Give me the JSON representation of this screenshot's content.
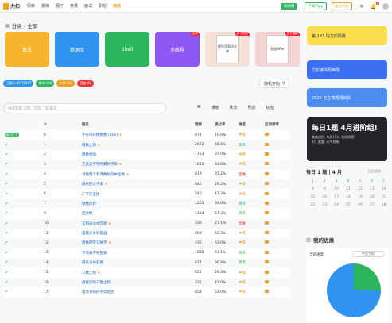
{
  "header": {
    "logo_text": "力扣",
    "nav": [
      "探索",
      "题库",
      "圈子",
      "竞赛",
      "面试",
      "职位"
    ],
    "nav_highlight": "商店",
    "biweek": "双周赛",
    "app": "下载 App",
    "member": "会员中心",
    "lang": "中",
    "notification_count": "4"
  },
  "categories": {
    "title": "分类 - 全部",
    "cards": [
      {
        "label": "算法",
        "color": "#f6b52c"
      },
      {
        "label": "数据库",
        "color": "#2f94f0"
      },
      {
        "label": "Shell",
        "color": "#2db55d"
      },
      {
        "label": "多线程",
        "color": "#8e56f2",
        "tag": "全新"
      },
      {
        "label": "",
        "tag": "新书预售",
        "book": "程序员面试金典"
      },
      {
        "label": "",
        "tag": "官方题解",
        "book": "剑指Offer"
      }
    ]
  },
  "stats": {
    "solved": "已解决 497/1587",
    "easy": "简单 166",
    "medium": "中等 249",
    "hard": "困难 82"
  },
  "random_button": "随机开始",
  "search": {
    "placeholder": "搜索题目 名称、内容、或 编号"
  },
  "filters": [
    "列表",
    "难度",
    "状态",
    "列表",
    "标签"
  ],
  "table": {
    "headers": [
      "#",
      "题名",
      "题解",
      "通过率",
      "难度",
      "出现频率"
    ],
    "rows": [
      {
        "status": "daily",
        "daily_label": "每日打卡",
        "id": "8",
        "title": "字符串转换整数 (atoi)",
        "star": true,
        "sol": "874",
        "acc": "19.0%",
        "diff": "中等",
        "dclass": "med"
      },
      {
        "status": "done",
        "id": "1",
        "title": "两数之和",
        "star": true,
        "sol": "2672",
        "acc": "48.0%",
        "diff": "简单",
        "dclass": "easy"
      },
      {
        "status": "done",
        "id": "2",
        "title": "两数相加",
        "star": false,
        "sol": "1763",
        "acc": "37.0%",
        "diff": "中等",
        "dclass": "med"
      },
      {
        "status": "done",
        "id": "3",
        "title": "无重复字符的最长子串",
        "star": true,
        "sol": "1650",
        "acc": "33.6%",
        "diff": "中等",
        "dclass": "med"
      },
      {
        "status": "done",
        "id": "4",
        "title": "寻找两个有序数组的中位数",
        "star": true,
        "sol": "819",
        "acc": "37.2%",
        "diff": "困难",
        "dclass": "hard"
      },
      {
        "status": "done",
        "id": "5",
        "title": "最长回文子串",
        "star": true,
        "sol": "846",
        "acc": "29.2%",
        "diff": "中等",
        "dclass": "med"
      },
      {
        "status": "done",
        "id": "6",
        "title": "Z 字形变换",
        "star": false,
        "sol": "540",
        "acc": "47.3%",
        "diff": "中等",
        "dclass": "med"
      },
      {
        "status": "done",
        "id": "7",
        "title": "整数反转",
        "star": false,
        "sol": "1265",
        "acc": "34.0%",
        "diff": "简单",
        "dclass": "easy"
      },
      {
        "status": "done",
        "id": "9",
        "title": "回文数",
        "star": false,
        "sol": "1154",
        "acc": "57.3%",
        "diff": "简单",
        "dclass": "easy"
      },
      {
        "status": "done",
        "id": "10",
        "title": "正则表达式匹配",
        "star": true,
        "sol": "330",
        "acc": "27.1%",
        "diff": "困难",
        "dclass": "hard"
      },
      {
        "status": "done",
        "id": "11",
        "title": "盛最多水的容器",
        "star": false,
        "sol": "660",
        "acc": "62.3%",
        "diff": "中等",
        "dclass": "med"
      },
      {
        "status": "done",
        "id": "12",
        "title": "整数转罗马数字",
        "star": true,
        "sol": "436",
        "acc": "63.0%",
        "diff": "中等",
        "dclass": "med"
      },
      {
        "status": "done",
        "id": "13",
        "title": "罗马数字转整数",
        "star": false,
        "sol": "1025",
        "acc": "61.1%",
        "diff": "简单",
        "dclass": "easy"
      },
      {
        "status": "done",
        "id": "14",
        "title": "最长公共前缀",
        "star": false,
        "sol": "815",
        "acc": "36.8%",
        "diff": "简单",
        "dclass": "easy"
      },
      {
        "status": "done",
        "id": "15",
        "title": "三数之和",
        "star": true,
        "sol": "655",
        "acc": "26.3%",
        "diff": "中等",
        "dclass": "med"
      },
      {
        "status": "done",
        "id": "16",
        "title": "最接近的三数之和",
        "star": false,
        "sol": "335",
        "acc": "43.0%",
        "diff": "中等",
        "dclass": "med"
      },
      {
        "status": "done",
        "id": "17",
        "title": "电话号码的字母组合",
        "star": false,
        "sol": "658",
        "acc": "53.0%",
        "diff": "中等",
        "dclass": "med"
      }
    ]
  },
  "sidebar": {
    "banner1": "第 183 场力扣周赛",
    "banner2": "力扣读书周两周",
    "banner3": "2020 名企真题题目训",
    "banner4_title": "每日1题 4月进阶组!",
    "banner4_sub": "难度进阶, 每周打卡, 每周刷题!",
    "banner4_sub2": "4月 难度: 从中到难"
  },
  "calendar": {
    "title": "每日 1 题 | 4 月",
    "link": "历史挑战",
    "days": [
      "1",
      "2",
      "3",
      "4",
      "5",
      "6",
      "7",
      "8",
      "9",
      "10",
      "11",
      "12",
      "13",
      "14",
      "15",
      "16",
      "17",
      "18",
      "19",
      "20",
      "21",
      "22",
      "23",
      "24",
      "25",
      "26",
      "27",
      "28"
    ],
    "done": [
      "1",
      "2",
      "3",
      "4",
      "5",
      "6",
      "7"
    ]
  },
  "progress": {
    "title": "我的进展",
    "label": "当前进度",
    "select": "中文力扣",
    "chart_data": {
      "type": "pie",
      "values": [
        0.25,
        0.75
      ],
      "colors": [
        "#2db55d",
        "#2f94f0"
      ]
    }
  }
}
